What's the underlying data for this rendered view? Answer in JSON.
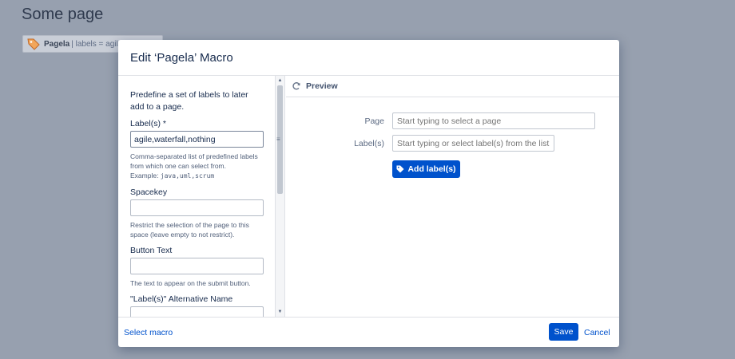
{
  "page": {
    "title": "Some page"
  },
  "chip": {
    "name": "Pagela",
    "meta": "| labels = agile,w",
    "icon": "tag-icon"
  },
  "dialog": {
    "title": "Edit ‘Pagela’ Macro",
    "form": {
      "intro": "Predefine a set of labels to later add to a page.",
      "labels_label": "Label(s) *",
      "labels_value": "agile,waterfall,nothing",
      "labels_help": "Comma-separated list of predefined labels from which one can select from.",
      "labels_example_prefix": "Example: ",
      "labels_example": "java,uml,scrum",
      "spacekey_label": "Spacekey",
      "spacekey_value": "",
      "spacekey_help": "Restrict the selection of the page to this space (leave empty to not restrict).",
      "button_text_label": "Button Text",
      "button_text_value": "",
      "button_text_help": "The text to appear on the submit button.",
      "alt_name_label": "\"Label(s)\" Alternative Name",
      "alt_name_value": ""
    },
    "preview": {
      "heading": "Preview",
      "refresh_icon": "refresh-icon",
      "page_label": "Page",
      "page_placeholder": "Start typing to select a page",
      "labels_label": "Label(s)",
      "labels_placeholder": "Start typing or select label(s) from the list",
      "add_button": "Add label(s)",
      "add_icon": "tag-icon"
    },
    "footer": {
      "select_macro": "Select macro",
      "save": "Save",
      "cancel": "Cancel"
    }
  },
  "colors": {
    "overlay": "#97a0af",
    "primary": "#0052cc",
    "text": "#172b4d"
  }
}
